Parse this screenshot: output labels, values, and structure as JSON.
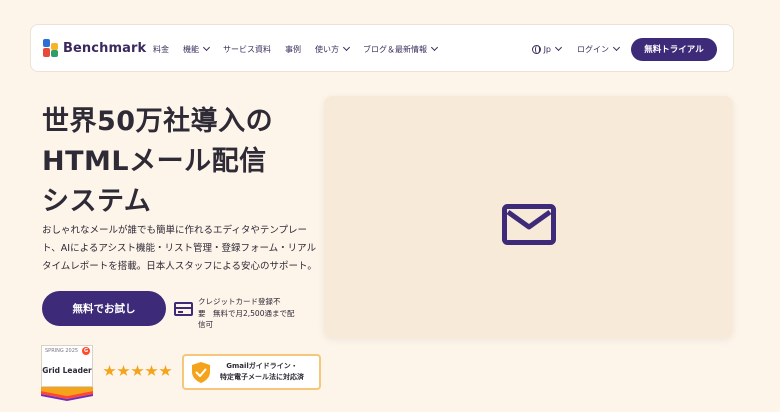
{
  "nav": {
    "brand": "Benchmark",
    "items": [
      {
        "label": "料金",
        "dropdown": false
      },
      {
        "label": "機能",
        "dropdown": true
      },
      {
        "label": "サービス資料",
        "dropdown": false
      },
      {
        "label": "事例",
        "dropdown": false
      },
      {
        "label": "使い方",
        "dropdown": true
      },
      {
        "label": "ブログ＆最新情報",
        "dropdown": true
      }
    ],
    "language": "Jp",
    "login": "ログイン",
    "trial_button": "無料トライアル"
  },
  "hero": {
    "headline_lines": [
      "世界50万社導入の",
      "HTMLメール配信",
      "システム"
    ],
    "lead_lines": [
      "おしゃれなメールが誰でも簡単に作れるエディタやテンプレー",
      "ト、AIによるアシスト機能・リスト管理・登録フォーム・リアル",
      "タイムレポートを搭載。日本人スタッフによる安心のサポート。"
    ],
    "cta_label": "無料でお試し",
    "card_note_lines": [
      "クレジットカード登録不",
      "要　無料で月2,500通まで配",
      "信可"
    ]
  },
  "badges": {
    "g2_season": "SPRING 2025",
    "g2_logo": "G",
    "g2_title": "Grid Leader",
    "stars": 5,
    "gmail_lines": [
      "Gmailガイドライン・",
      "特定電子メール法に対応済"
    ]
  },
  "colors": {
    "brand_purple": "#3d2a78",
    "background": "#fdf4ea",
    "media_panel": "#f8ead9",
    "star": "#f4a31a",
    "badge_border": "#f6c77a"
  },
  "icons": [
    "benchmark-logo-icon",
    "chevron-down-icon",
    "globe-icon",
    "credit-card-icon",
    "g2-badge-icon",
    "star-icon",
    "shield-check-icon",
    "mail-icon"
  ]
}
